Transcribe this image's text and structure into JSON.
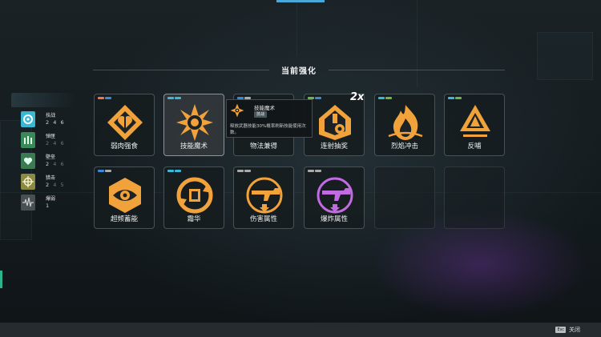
{
  "section_title": "当前强化",
  "colors": {
    "orange": "#f2a23a",
    "purple": "#c06be0",
    "accent_blue": "#49a8d8"
  },
  "stats": [
    {
      "name": "技战",
      "vals": [
        "2",
        "4",
        "6"
      ],
      "lit": 3,
      "icon": "swirl-icon",
      "color": "#39b8d4"
    },
    {
      "name": "弹匣",
      "vals": [
        "2",
        "4",
        "6"
      ],
      "lit": 0,
      "icon": "magazine-icon",
      "color": "#3a8a58"
    },
    {
      "name": "壁垒",
      "vals": [
        "2",
        "4",
        "6"
      ],
      "lit": 1,
      "icon": "heart-shield-icon",
      "color": "#3c7a52"
    },
    {
      "name": "猎击",
      "vals": [
        "2",
        "4",
        "5"
      ],
      "lit": 1,
      "icon": "crosshair-icon",
      "color": "#8a8a42"
    },
    {
      "name": "爆弱",
      "vals": [
        "1"
      ],
      "lit": 1,
      "icon": "wave-icon",
      "color": "#4a5052"
    }
  ],
  "cards_row1": [
    {
      "label": "弱肉强食",
      "icon": "heart-hands-icon",
      "color": "orange",
      "tag": [
        "#ee7744",
        "#3b8ad8"
      ]
    },
    {
      "label": "技能魔术",
      "icon": "star-burst-icon",
      "color": "orange",
      "tag": [
        "#3bb8d8",
        "#3bb8d8"
      ],
      "selected": true
    },
    {
      "label": "物法兼得",
      "icon": "",
      "color": "orange",
      "tag": [
        "#3b8ad8",
        "#aaaaaa"
      ]
    },
    {
      "label": "连射抽奖",
      "icon": "lottery-icon",
      "color": "orange",
      "tag": [
        "#6ab848",
        "#3b8ad8"
      ],
      "badge": "2x"
    },
    {
      "label": "烈焰冲击",
      "icon": "flame-icon",
      "color": "orange",
      "tag": [
        "#3bb8d8",
        "#6ab848"
      ]
    },
    {
      "label": "反哺",
      "icon": "crystal-icon",
      "color": "orange",
      "tag": [
        "#3bb8d8",
        "#6ab848"
      ]
    }
  ],
  "cards_row2": [
    {
      "label": "超频蓄能",
      "icon": "eye-icon",
      "color": "orange",
      "tag": [
        "#3b8ad8",
        "#aaaaaa"
      ]
    },
    {
      "label": "霜华",
      "icon": "frost-cycle-icon",
      "color": "orange",
      "tag": [
        "#3bb8d8",
        "#3bb8d8"
      ]
    },
    {
      "label": "伤害属性",
      "icon": "gun-damage-icon",
      "color": "orange",
      "tag": [
        "#aaaaaa",
        "#aaaaaa"
      ]
    },
    {
      "label": "爆炸属性",
      "icon": "gun-explode-icon",
      "color": "purple",
      "tag": [
        "#aaaaaa",
        "#aaaaaa"
      ]
    },
    {
      "label": "",
      "empty": true
    },
    {
      "label": "",
      "empty": true
    }
  ],
  "tooltip": {
    "title": "技能魔术",
    "chip": "技战",
    "desc": "释放武器技能30%概率刷新技能使用次数。"
  },
  "bottom": {
    "close_key": "Esc",
    "close_label": "关闭"
  }
}
